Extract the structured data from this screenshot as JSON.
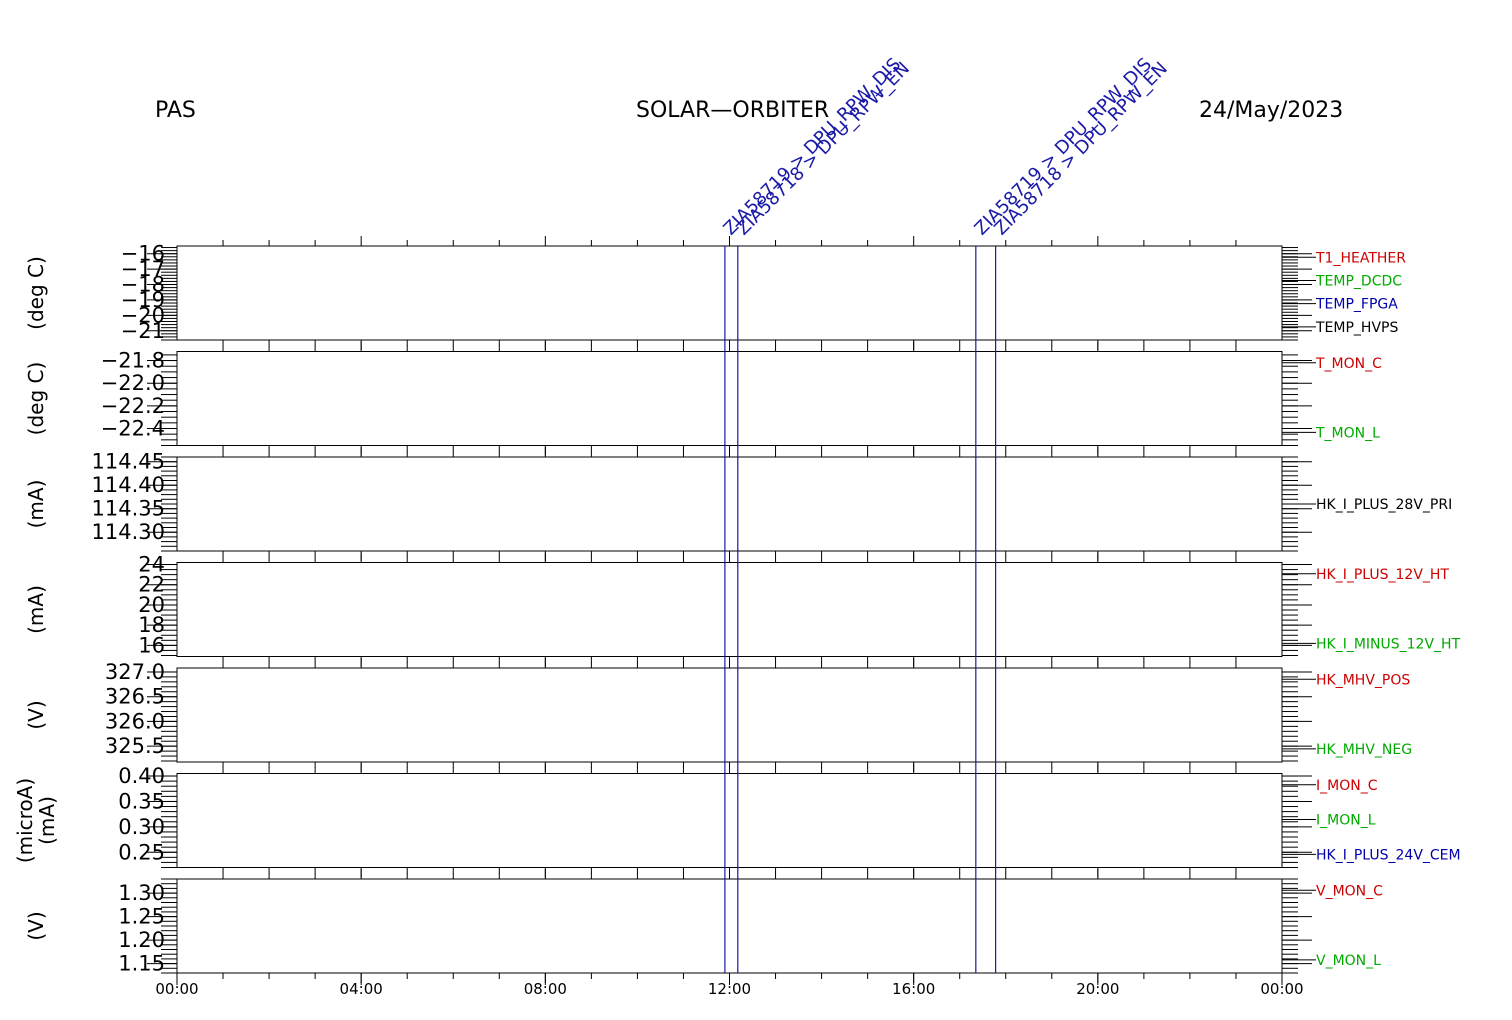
{
  "header": {
    "left": "PAS",
    "center": "SOLAR—ORBITER",
    "right": "24/May/2023"
  },
  "colors": {
    "red": "#cc0000",
    "green": "#00aa00",
    "blue": "#0000aa",
    "black": "#000000",
    "event": "#1a1aa8"
  },
  "chart_data": {
    "type": "line",
    "x_axis": {
      "range_hours": [
        0,
        24
      ],
      "ticks": [
        {
          "label": "00:00",
          "hours": 0
        },
        {
          "label": "04:00",
          "hours": 4
        },
        {
          "label": "08:00",
          "hours": 8
        },
        {
          "label": "12:00",
          "hours": 12
        },
        {
          "label": "16:00",
          "hours": 16
        },
        {
          "label": "20:00",
          "hours": 20
        },
        {
          "label": "00:00",
          "hours": 24
        }
      ]
    },
    "events": [
      {
        "hours": 11.9,
        "label": "ZIA58719 > DPU_RPW_DIS"
      },
      {
        "hours": 12.18,
        "label": "ZIA58718 > DPU_RPW_EN"
      },
      {
        "hours": 17.35,
        "label": "ZIA58719 > DPU_RPW_DIS"
      },
      {
        "hours": 17.78,
        "label": "ZIA58718 > DPU_RPW_EN"
      }
    ],
    "panels": [
      {
        "ylabel": [
          "(deg C)"
        ],
        "ylim": [
          -21.6,
          -15.5
        ],
        "ticks": [
          {
            "v": -16,
            "label": "−16"
          },
          {
            "v": -17,
            "label": "−17"
          },
          {
            "v": -18,
            "label": "−18"
          },
          {
            "v": -19,
            "label": "−19"
          },
          {
            "v": -20,
            "label": "−20"
          },
          {
            "v": -21,
            "label": "−21"
          }
        ],
        "minor_step": 0.2,
        "series": [
          {
            "name": "T1_HEATHER",
            "color": "red"
          },
          {
            "name": "TEMP_DCDC",
            "color": "green"
          },
          {
            "name": "TEMP_FPGA",
            "color": "blue"
          },
          {
            "name": "TEMP_HVPS",
            "color": "black"
          }
        ]
      },
      {
        "ylabel": [
          "(deg C)"
        ],
        "ylim": [
          -22.55,
          -21.72
        ],
        "ticks": [
          {
            "v": -21.8,
            "label": "−21.8"
          },
          {
            "v": -22.0,
            "label": "−22.0"
          },
          {
            "v": -22.2,
            "label": "−22.2"
          },
          {
            "v": -22.4,
            "label": "−22.4"
          }
        ],
        "minor_step": 0.05,
        "series": [
          {
            "name": "T_MON_C",
            "color": "red"
          },
          {
            "name": "T_MON_L",
            "color": "green"
          }
        ]
      },
      {
        "ylabel": [
          "(mA)"
        ],
        "ylim": [
          114.26,
          114.46
        ],
        "ticks": [
          {
            "v": 114.45,
            "label": "114.45"
          },
          {
            "v": 114.4,
            "label": "114.40"
          },
          {
            "v": 114.35,
            "label": "114.35"
          },
          {
            "v": 114.3,
            "label": "114.30"
          }
        ],
        "minor_step": 0.01,
        "series": [
          {
            "name": "HK_I_PLUS_28V_PRI",
            "color": "black"
          }
        ]
      },
      {
        "ylabel": [
          "(mA)"
        ],
        "ylim": [
          14.9,
          24.2
        ],
        "ticks": [
          {
            "v": 24,
            "label": "24"
          },
          {
            "v": 22,
            "label": "22"
          },
          {
            "v": 20,
            "label": "20"
          },
          {
            "v": 18,
            "label": "18"
          },
          {
            "v": 16,
            "label": "16"
          }
        ],
        "minor_step": 0.5,
        "series": [
          {
            "name": "HK_I_PLUS_12V_HT",
            "color": "red"
          },
          {
            "name": "HK_I_MINUS_12V_HT",
            "color": "green"
          }
        ]
      },
      {
        "ylabel": [
          "(V)"
        ],
        "ylim": [
          325.18,
          327.08
        ],
        "ticks": [
          {
            "v": 327.0,
            "label": "327.0"
          },
          {
            "v": 326.5,
            "label": "326.5"
          },
          {
            "v": 326.0,
            "label": "326.0"
          },
          {
            "v": 325.5,
            "label": "325.5"
          }
        ],
        "minor_step": 0.1,
        "series": [
          {
            "name": "HK_MHV_POS",
            "color": "red"
          },
          {
            "name": "HK_MHV_NEG",
            "color": "green"
          }
        ]
      },
      {
        "ylabel": [
          "(microA)",
          "(mA)"
        ],
        "ylim": [
          0.22,
          0.405
        ],
        "ticks": [
          {
            "v": 0.4,
            "label": "0.40"
          },
          {
            "v": 0.35,
            "label": "0.35"
          },
          {
            "v": 0.3,
            "label": "0.30"
          },
          {
            "v": 0.25,
            "label": "0.25"
          }
        ],
        "minor_step": 0.01,
        "series": [
          {
            "name": "I_MON_C",
            "color": "red"
          },
          {
            "name": "I_MON_L",
            "color": "green"
          },
          {
            "name": "HK_I_PLUS_24V_CEM",
            "color": "blue"
          }
        ]
      },
      {
        "ylabel": [
          "(V)"
        ],
        "ylim": [
          1.13,
          1.33
        ],
        "ticks": [
          {
            "v": 1.3,
            "label": "1.30"
          },
          {
            "v": 1.25,
            "label": "1.25"
          },
          {
            "v": 1.2,
            "label": "1.20"
          },
          {
            "v": 1.15,
            "label": "1.15"
          }
        ],
        "minor_step": 0.01,
        "series": [
          {
            "name": "V_MON_C",
            "color": "red"
          },
          {
            "name": "V_MON_L",
            "color": "green"
          }
        ]
      }
    ]
  }
}
